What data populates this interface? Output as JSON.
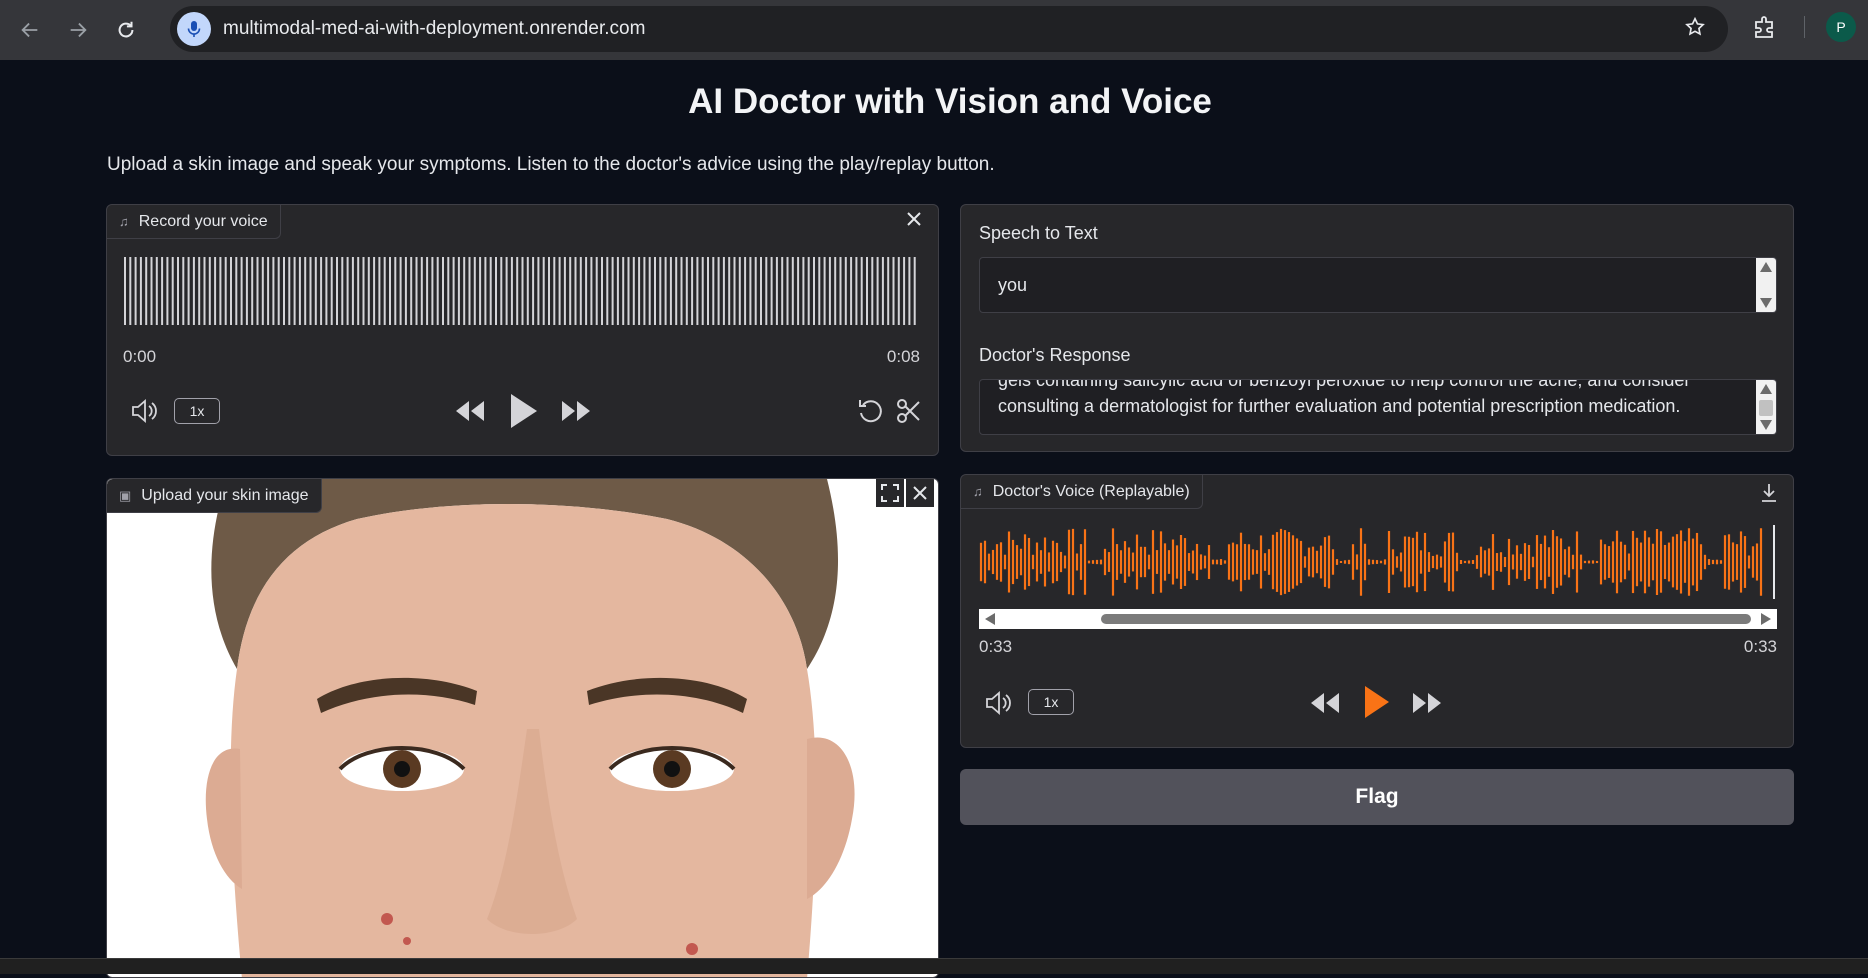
{
  "browser": {
    "url": "multimodal-med-ai-with-deployment.onrender.com",
    "profile_initial": "P"
  },
  "page": {
    "title": "AI Doctor with Vision and Voice",
    "description": "Upload a skin image and speak your symptoms. Listen to the doctor's advice using the play/replay button."
  },
  "record_panel": {
    "label": "Record your voice",
    "time_start": "0:00",
    "time_end": "0:08",
    "playback_rate": "1x"
  },
  "image_panel": {
    "label": "Upload your skin image"
  },
  "speech_to_text": {
    "label": "Speech to Text",
    "value": "you"
  },
  "doctor_response": {
    "label": "Doctor's Response",
    "line1": "gels containing salicylic acid or benzoyl peroxide to help control the acne, and consider",
    "line2": "consulting a dermatologist for further evaluation and potential prescription medication."
  },
  "voice_panel": {
    "label": "Doctor's Voice (Replayable)",
    "time_current": "0:33",
    "time_total": "0:33",
    "playback_rate": "1x",
    "accent_color": "#f97316"
  },
  "actions": {
    "flag_label": "Flag"
  }
}
